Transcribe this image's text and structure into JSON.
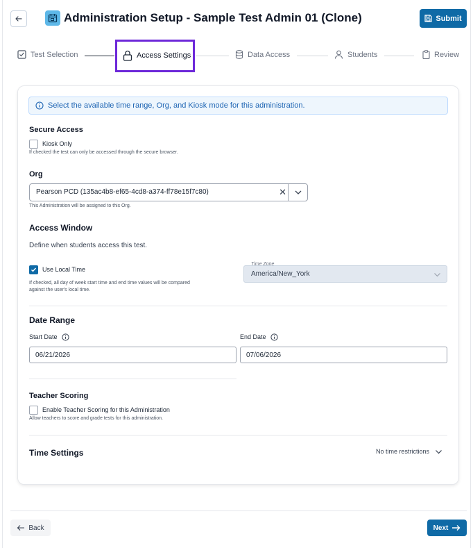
{
  "header": {
    "title": "Administration Setup - Sample Test Admin 01 (Clone)",
    "submit_label": "Submit"
  },
  "stepper": {
    "steps": [
      {
        "label": "Test Selection",
        "icon": "checkbox-icon",
        "state": "done"
      },
      {
        "label": "Access Settings",
        "icon": "lock-icon",
        "state": "active"
      },
      {
        "label": "Data Access",
        "icon": "database-icon",
        "state": "pending"
      },
      {
        "label": "Students",
        "icon": "user-icon",
        "state": "pending"
      },
      {
        "label": "Review",
        "icon": "clipboard-icon",
        "state": "pending"
      }
    ]
  },
  "banner": {
    "text": "Select the available time range, Org, and Kiosk mode for this administration."
  },
  "secure_access": {
    "heading": "Secure Access",
    "kiosk_label": "Kiosk Only",
    "kiosk_checked": false,
    "kiosk_help": "If checked the test can only be accessed through the secure browser."
  },
  "org": {
    "heading": "Org",
    "value": "Pearson PCD (135ac4b8-ef65-4cd8-a374-ff78e15f7c80)",
    "help": "This Administration will be assigned to this Org."
  },
  "access_window": {
    "heading": "Access Window",
    "description": "Define when students access this test.",
    "local_time_label": "Use Local Time",
    "local_time_checked": true,
    "local_time_help_1": "If checked, all day of week start time and end time values will be compared",
    "local_time_help_2": "against the user's local time.",
    "timezone_label": "Time Zone",
    "timezone_value": "America/New_York"
  },
  "date_range": {
    "heading": "Date Range",
    "start_label": "Start Date",
    "start_value": "06/21/2026",
    "end_label": "End Date",
    "end_value": "07/06/2026"
  },
  "teacher_scoring": {
    "heading": "Teacher Scoring",
    "checkbox_label": "Enable Teacher Scoring for this Administration",
    "checked": false,
    "help": "Allow teachers to score and grade tests for this administration."
  },
  "time_settings": {
    "heading": "Time Settings",
    "summary": "No time restrictions"
  },
  "footer": {
    "back_label": "Back",
    "next_label": "Next"
  },
  "colors": {
    "primary": "#0f6aa6",
    "highlight": "#6d28d9",
    "banner_bg": "#eef6fd",
    "banner_text": "#1d64b3"
  }
}
